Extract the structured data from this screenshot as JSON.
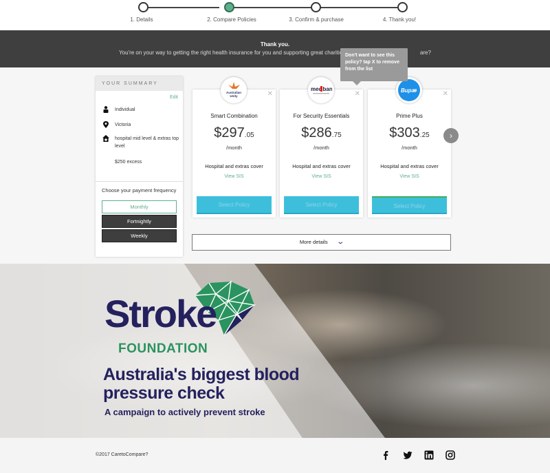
{
  "stepper": {
    "steps": [
      {
        "label": "1. Details"
      },
      {
        "label": "2. Compare Policies"
      },
      {
        "label": "3. Confirm & purchase"
      },
      {
        "label": "4. Thank you!"
      }
    ],
    "active_step": 2
  },
  "banner": {
    "title": "Thank you.",
    "message": "You're on your way to getting the right health insurance for you and supporting great charities whe",
    "message_tail": "are?"
  },
  "tooltip": {
    "text": "Don't want to see this policy? tap X to remove from the list"
  },
  "summary": {
    "heading": "YOUR SUMMARY",
    "edit_label": "Edit",
    "items": [
      {
        "icon": "person-icon",
        "text": "Individual"
      },
      {
        "icon": "location-pin-icon",
        "text": "Victoria"
      },
      {
        "icon": "house-plus-icon",
        "text": "hospital mid level & extras top level"
      },
      {
        "icon": "",
        "text": "$250 excess"
      }
    ],
    "payment_label": "Choose your payment frequency",
    "payment_options": [
      "Monthly",
      "Fortnightly",
      "Weekly"
    ],
    "payment_selected": "Monthly"
  },
  "policies": [
    {
      "brand": "Australian Unity",
      "name": "Smart Combination",
      "dollars": "$297",
      "cents": ".05",
      "per": "/month",
      "cover": "Hospital and extras cover",
      "sis": "View SIS",
      "select": "Select Policy"
    },
    {
      "brand": "medibank",
      "name": "For Security Essentials",
      "dollars": "$286",
      "cents": ".75",
      "per": "/month",
      "cover": "Hospital and extras cover",
      "sis": "View SIS",
      "select": "Select Policy"
    },
    {
      "brand": "Bupa",
      "name": "Prime Plus",
      "dollars": "$303",
      "cents": ".25",
      "per": "/month",
      "cover": "Hospital and extras cover",
      "sis": "View SIS",
      "select": "Select Policy"
    }
  ],
  "more_details": "More details",
  "hero": {
    "org_name": "Stroke",
    "org_sub": "FOUNDATION",
    "headline": "Australia's biggest blood pressure check",
    "subline": "A campaign to actively prevent stroke"
  },
  "footer": {
    "copyright": "©2017 CaretoCompare?",
    "social": [
      "facebook-icon",
      "twitter-icon",
      "linkedin-icon",
      "instagram-icon"
    ]
  },
  "colors": {
    "accent_green": "#5fae8d",
    "select_blue": "#3dbfdc",
    "banner_dark": "#3f3f3f",
    "stroke_navy": "#24215e",
    "stroke_green": "#2b9360"
  }
}
